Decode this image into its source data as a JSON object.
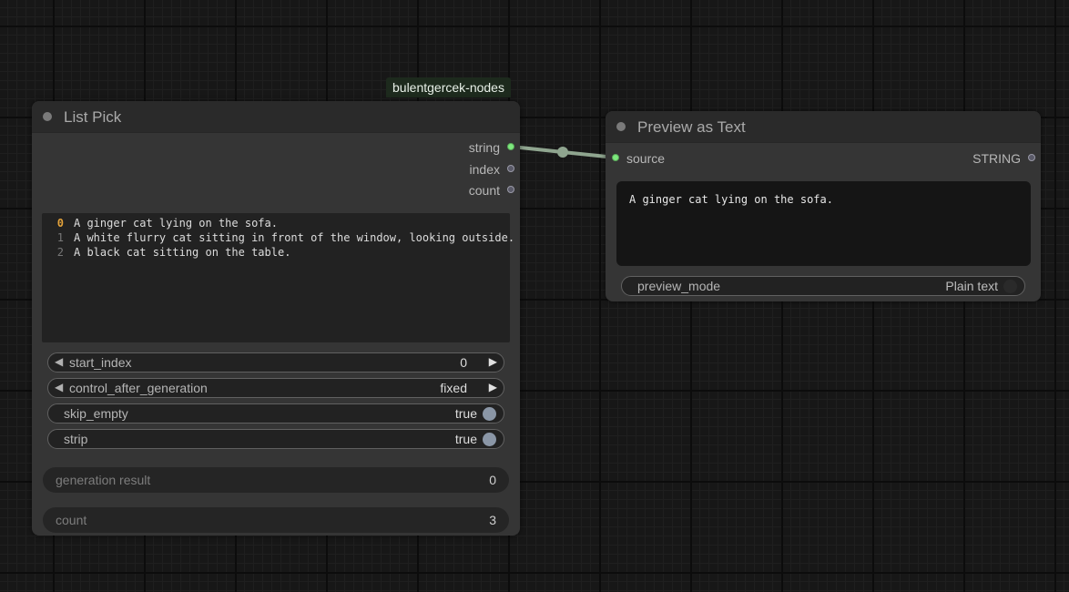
{
  "canvas": {
    "background": "#171717"
  },
  "list_pick": {
    "tag": "bulentgercek-nodes",
    "title": "List Pick",
    "outputs": [
      {
        "label": "string",
        "connected": true
      },
      {
        "label": "index",
        "connected": false
      },
      {
        "label": "count",
        "connected": false
      }
    ],
    "text_lines": [
      {
        "num": "0",
        "text": "A ginger cat lying on the sofa."
      },
      {
        "num": "1",
        "text": "A white flurry cat sitting in front of the window, looking outside."
      },
      {
        "num": "2",
        "text": "A black cat sitting on the table."
      }
    ],
    "widgets": {
      "start_index": {
        "label": "start_index",
        "value": "0"
      },
      "control_after_generation": {
        "label": "control_after_generation",
        "value": "fixed"
      },
      "skip_empty": {
        "label": "skip_empty",
        "value": "true"
      },
      "strip": {
        "label": "strip",
        "value": "true"
      }
    },
    "generation_result": {
      "label": "generation result",
      "value": "0"
    },
    "count": {
      "label": "count",
      "value": "3"
    }
  },
  "preview_as_text": {
    "title": "Preview as Text",
    "input": {
      "label": "source",
      "connected": true
    },
    "output": {
      "label": "STRING",
      "connected": false
    },
    "preview_text": "A ginger cat lying on the sofa.",
    "preview_mode": {
      "label": "preview_mode",
      "value": "Plain text"
    }
  },
  "colors": {
    "connected_slot": "#7de87d",
    "link": "#8fa58f",
    "highlight_line_number": "#e3a23a",
    "toggle_on": "#8a96a6"
  }
}
